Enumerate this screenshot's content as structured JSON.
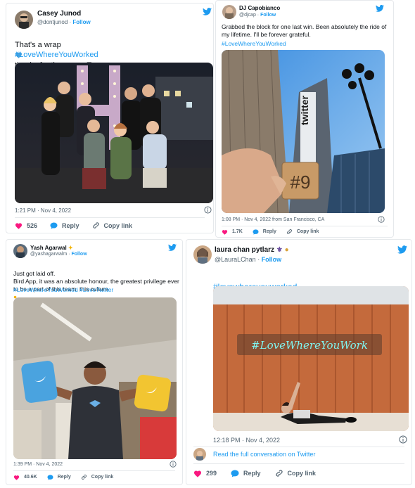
{
  "follow_label": "Follow",
  "reply_label": "Reply",
  "copy_link_label": "Copy link",
  "tweet1": {
    "name": "Casey Junod",
    "handle": "@dontjunod",
    "text": "That's a wrap",
    "text_after_icon": "thanks for the mems Tweeps",
    "hashtag": "#LoveWhereYouWorked",
    "timestamp": "1:21 PM · Nov 4, 2022",
    "likes": "526"
  },
  "tweet2": {
    "name": "DJ Capobianco",
    "handle": "@djcap",
    "text": "Grabbed the block for one last win. Been absolutely the ride of my lifetime. I'll be forever grateful.",
    "hashtag": "#LoveWhereYouWorked",
    "block_label": "#9",
    "building_sign": "twitter",
    "timestamp": "1:08 PM · Nov 4, 2022 from San Francisco, CA",
    "likes": "1.7K"
  },
  "tweet3": {
    "name": "Yash Agarwal",
    "handle": "@yashagarwalm",
    "text": "Just got laid off.\nBird App, it was an absolute honour, the greatest privilege ever to be a part of this team, this culture",
    "hashtags": "#LoveWhereYouWorked #LoveTwitter",
    "timestamp": "1:39 PM · Nov 4, 2022",
    "likes": "40.6K"
  },
  "tweet4": {
    "name": "laura chan pytlarz",
    "handle": "@LauraLChan",
    "hashtag": "#lovewhereyouworked",
    "neon_sign": "#LoveWhereYouWork",
    "timestamp": "12:18 PM · Nov 4, 2022",
    "read_more": "Read the full conversation on Twitter",
    "likes": "299"
  },
  "colors": {
    "accent": "#1d9bf0",
    "like": "#f91880",
    "muted": "#536471"
  }
}
